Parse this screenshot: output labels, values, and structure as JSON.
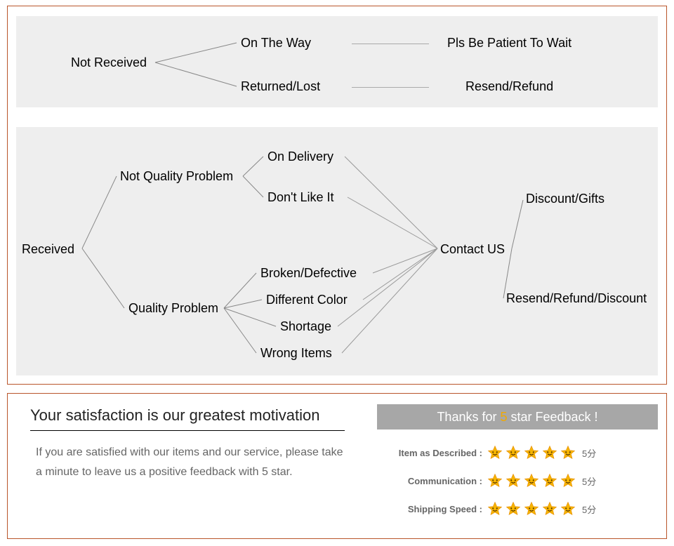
{
  "panel1": {
    "box1": {
      "root": "Not Received",
      "on_the_way": "On The Way",
      "returned_lost": "Returned/Lost",
      "wait": "Pls Be Patient To Wait",
      "resend": "Resend/Refund"
    },
    "box2": {
      "root": "Received",
      "nqp": "Not Quality Problem",
      "qp": "Quality Problem",
      "on_delivery": "On Delivery",
      "dont_like": "Don't Like It",
      "broken": "Broken/Defective",
      "diff_color": "Different Color",
      "shortage": "Shortage",
      "wrong": "Wrong Items",
      "contact": "Contact US",
      "discount_gifts": "Discount/Gifts",
      "resend_refund_discount": "Resend/Refund/Discount"
    }
  },
  "panel2": {
    "headline": "Your satisfaction is our greatest motivation",
    "sub": "If you are satisfied with our items and our service, please take a minute to leave us a positive feedback with 5 star.",
    "thanks_pre": "Thanks for ",
    "thanks_five": "5",
    "thanks_post": " star Feedback !",
    "thanks_bg": "#a7a7a7",
    "rows": [
      {
        "label": "Item as Described :",
        "score": "5分"
      },
      {
        "label": "Communication :",
        "score": "5分"
      },
      {
        "label": "Shipping Speed :",
        "score": "5分"
      }
    ],
    "star_fill": "#f6b400",
    "star_stroke": "#e58a00"
  }
}
